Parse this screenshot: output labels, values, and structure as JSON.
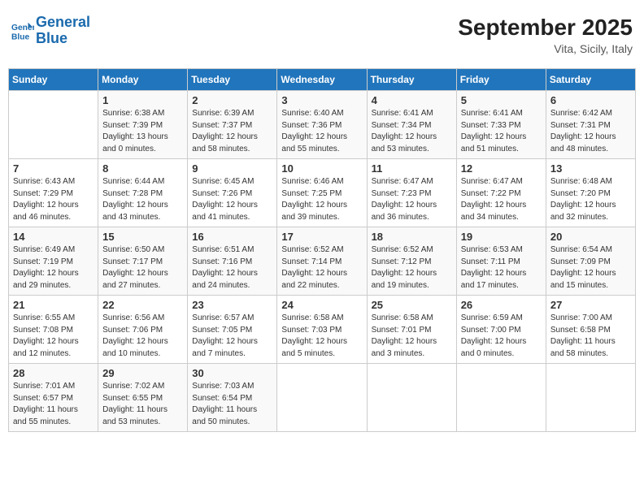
{
  "header": {
    "logo_line1": "General",
    "logo_line2": "Blue",
    "month_title": "September 2025",
    "subtitle": "Vita, Sicily, Italy"
  },
  "weekdays": [
    "Sunday",
    "Monday",
    "Tuesday",
    "Wednesday",
    "Thursday",
    "Friday",
    "Saturday"
  ],
  "weeks": [
    [
      {
        "day": "",
        "info": ""
      },
      {
        "day": "1",
        "info": "Sunrise: 6:38 AM\nSunset: 7:39 PM\nDaylight: 13 hours\nand 0 minutes."
      },
      {
        "day": "2",
        "info": "Sunrise: 6:39 AM\nSunset: 7:37 PM\nDaylight: 12 hours\nand 58 minutes."
      },
      {
        "day": "3",
        "info": "Sunrise: 6:40 AM\nSunset: 7:36 PM\nDaylight: 12 hours\nand 55 minutes."
      },
      {
        "day": "4",
        "info": "Sunrise: 6:41 AM\nSunset: 7:34 PM\nDaylight: 12 hours\nand 53 minutes."
      },
      {
        "day": "5",
        "info": "Sunrise: 6:41 AM\nSunset: 7:33 PM\nDaylight: 12 hours\nand 51 minutes."
      },
      {
        "day": "6",
        "info": "Sunrise: 6:42 AM\nSunset: 7:31 PM\nDaylight: 12 hours\nand 48 minutes."
      }
    ],
    [
      {
        "day": "7",
        "info": "Sunrise: 6:43 AM\nSunset: 7:29 PM\nDaylight: 12 hours\nand 46 minutes."
      },
      {
        "day": "8",
        "info": "Sunrise: 6:44 AM\nSunset: 7:28 PM\nDaylight: 12 hours\nand 43 minutes."
      },
      {
        "day": "9",
        "info": "Sunrise: 6:45 AM\nSunset: 7:26 PM\nDaylight: 12 hours\nand 41 minutes."
      },
      {
        "day": "10",
        "info": "Sunrise: 6:46 AM\nSunset: 7:25 PM\nDaylight: 12 hours\nand 39 minutes."
      },
      {
        "day": "11",
        "info": "Sunrise: 6:47 AM\nSunset: 7:23 PM\nDaylight: 12 hours\nand 36 minutes."
      },
      {
        "day": "12",
        "info": "Sunrise: 6:47 AM\nSunset: 7:22 PM\nDaylight: 12 hours\nand 34 minutes."
      },
      {
        "day": "13",
        "info": "Sunrise: 6:48 AM\nSunset: 7:20 PM\nDaylight: 12 hours\nand 32 minutes."
      }
    ],
    [
      {
        "day": "14",
        "info": "Sunrise: 6:49 AM\nSunset: 7:19 PM\nDaylight: 12 hours\nand 29 minutes."
      },
      {
        "day": "15",
        "info": "Sunrise: 6:50 AM\nSunset: 7:17 PM\nDaylight: 12 hours\nand 27 minutes."
      },
      {
        "day": "16",
        "info": "Sunrise: 6:51 AM\nSunset: 7:16 PM\nDaylight: 12 hours\nand 24 minutes."
      },
      {
        "day": "17",
        "info": "Sunrise: 6:52 AM\nSunset: 7:14 PM\nDaylight: 12 hours\nand 22 minutes."
      },
      {
        "day": "18",
        "info": "Sunrise: 6:52 AM\nSunset: 7:12 PM\nDaylight: 12 hours\nand 19 minutes."
      },
      {
        "day": "19",
        "info": "Sunrise: 6:53 AM\nSunset: 7:11 PM\nDaylight: 12 hours\nand 17 minutes."
      },
      {
        "day": "20",
        "info": "Sunrise: 6:54 AM\nSunset: 7:09 PM\nDaylight: 12 hours\nand 15 minutes."
      }
    ],
    [
      {
        "day": "21",
        "info": "Sunrise: 6:55 AM\nSunset: 7:08 PM\nDaylight: 12 hours\nand 12 minutes."
      },
      {
        "day": "22",
        "info": "Sunrise: 6:56 AM\nSunset: 7:06 PM\nDaylight: 12 hours\nand 10 minutes."
      },
      {
        "day": "23",
        "info": "Sunrise: 6:57 AM\nSunset: 7:05 PM\nDaylight: 12 hours\nand 7 minutes."
      },
      {
        "day": "24",
        "info": "Sunrise: 6:58 AM\nSunset: 7:03 PM\nDaylight: 12 hours\nand 5 minutes."
      },
      {
        "day": "25",
        "info": "Sunrise: 6:58 AM\nSunset: 7:01 PM\nDaylight: 12 hours\nand 3 minutes."
      },
      {
        "day": "26",
        "info": "Sunrise: 6:59 AM\nSunset: 7:00 PM\nDaylight: 12 hours\nand 0 minutes."
      },
      {
        "day": "27",
        "info": "Sunrise: 7:00 AM\nSunset: 6:58 PM\nDaylight: 11 hours\nand 58 minutes."
      }
    ],
    [
      {
        "day": "28",
        "info": "Sunrise: 7:01 AM\nSunset: 6:57 PM\nDaylight: 11 hours\nand 55 minutes."
      },
      {
        "day": "29",
        "info": "Sunrise: 7:02 AM\nSunset: 6:55 PM\nDaylight: 11 hours\nand 53 minutes."
      },
      {
        "day": "30",
        "info": "Sunrise: 7:03 AM\nSunset: 6:54 PM\nDaylight: 11 hours\nand 50 minutes."
      },
      {
        "day": "",
        "info": ""
      },
      {
        "day": "",
        "info": ""
      },
      {
        "day": "",
        "info": ""
      },
      {
        "day": "",
        "info": ""
      }
    ]
  ]
}
